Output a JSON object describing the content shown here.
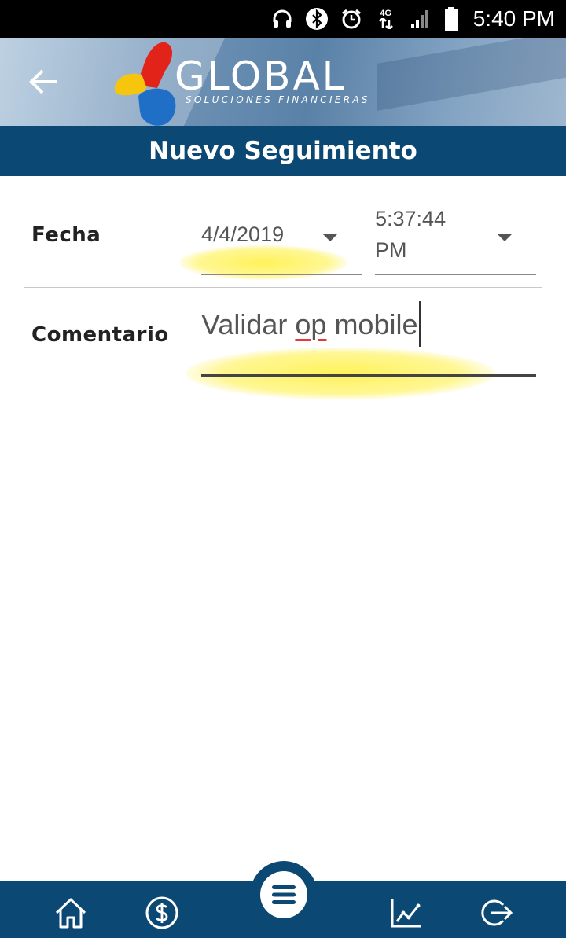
{
  "status_bar": {
    "time": "5:40 PM",
    "network": "4G",
    "icons": [
      "headset-icon",
      "bluetooth-icon",
      "alarm-icon",
      "network-4g-icon",
      "signal-icon",
      "battery-icon"
    ]
  },
  "header": {
    "brand_name": "GLOBAL",
    "brand_tagline": "SOLUCIONES FINANCIERAS",
    "title": "Nuevo Seguimiento"
  },
  "form": {
    "fecha": {
      "label": "Fecha",
      "date_value": "4/4/2019",
      "time_value_line1": "5:37:44",
      "time_value_line2": "PM"
    },
    "comentario": {
      "label": "Comentario",
      "value_before": "Validar ",
      "value_misspelled": "op",
      "value_after": " mobile"
    }
  },
  "bottom_nav": {
    "items": [
      "home-icon",
      "dollar-icon",
      "menu-icon",
      "chart-icon",
      "logout-icon"
    ]
  },
  "colors": {
    "primary": "#0c4874",
    "highlight": "#fff03c",
    "spell_error": "#e53935"
  }
}
